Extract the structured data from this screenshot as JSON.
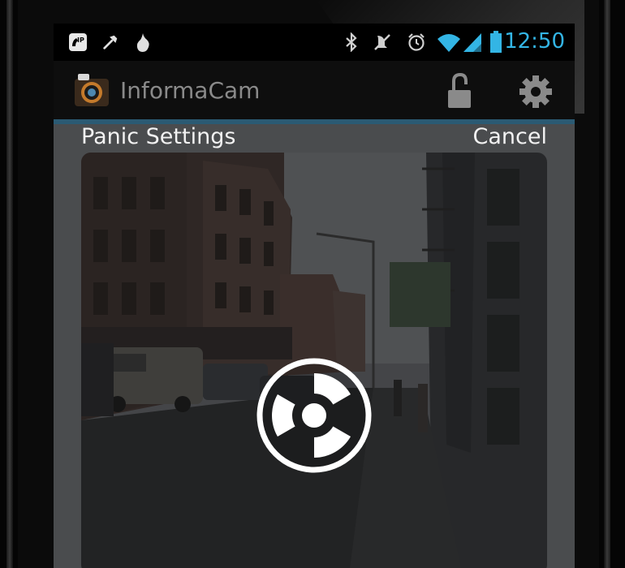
{
  "status_bar": {
    "time": "12:50",
    "icons": [
      "ip-icon",
      "hammer-icon",
      "fire-icon",
      "bluetooth-icon",
      "mute-icon",
      "alarm-icon",
      "wifi-icon",
      "signal-icon",
      "battery-icon"
    ],
    "accent": "#33b5e5"
  },
  "action_bar": {
    "app_title": "InformaCam",
    "icons": [
      "camera-app-icon",
      "unlock-icon",
      "gear-icon"
    ]
  },
  "dialog": {
    "title": "Panic Settings",
    "cancel_label": "Cancel",
    "center_icon": "radiation-icon"
  },
  "colors": {
    "accent_bar": "#2b5a73",
    "overlay": "#4a4c4e"
  }
}
